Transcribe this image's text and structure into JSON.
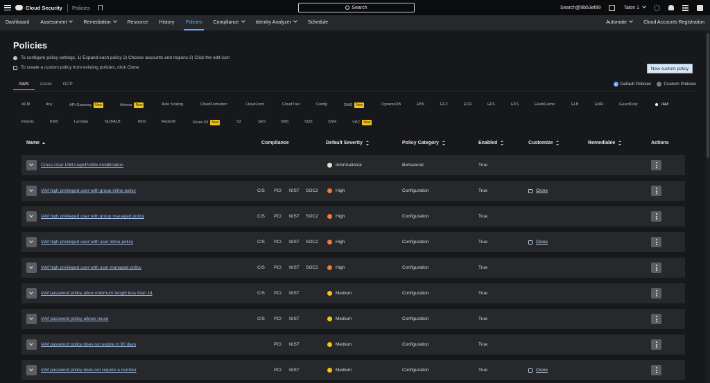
{
  "topbar": {
    "brand": "Cloud Security",
    "section": "Policies",
    "search_label": "Search",
    "account": "Search@9b53ef89",
    "user": "Talon 1"
  },
  "nav": {
    "items": [
      {
        "label": "Dashboard",
        "dropdown": false
      },
      {
        "label": "Assessment",
        "dropdown": true
      },
      {
        "label": "Remediation",
        "dropdown": true
      },
      {
        "label": "Resource",
        "dropdown": false
      },
      {
        "label": "History",
        "dropdown": false
      },
      {
        "label": "Policies",
        "dropdown": false,
        "active": true
      },
      {
        "label": "Compliance",
        "dropdown": true
      },
      {
        "label": "Identity Analyzer",
        "dropdown": true
      },
      {
        "label": "Schedule",
        "dropdown": false
      }
    ],
    "right": [
      {
        "label": "Automate",
        "dropdown": true
      },
      {
        "label": "Cloud Accounts Registration",
        "dropdown": false
      }
    ]
  },
  "page": {
    "title": "Policies",
    "info1": "To configure policy settings, 1) Expand each policy 2) Choose accounts and regions 3) Click the edit icon",
    "info2": "To create a custom policy from existing policies, click Clone",
    "new_policy_button": "New custom policy"
  },
  "cloud_tabs": [
    "AWS",
    "Azure",
    "GCP"
  ],
  "policy_filter": {
    "default_label": "Default Policies",
    "custom_label": "Custom Policies",
    "selected": "Default Policies"
  },
  "services_row1": [
    {
      "label": "ACM"
    },
    {
      "label": "Any"
    },
    {
      "label": "API Gateway",
      "badge": "New"
    },
    {
      "label": "Athena",
      "badge": "New"
    },
    {
      "label": "Auto Scaling"
    },
    {
      "label": "CloudFormation"
    },
    {
      "label": "CloudFront"
    },
    {
      "label": "CloudTrail"
    },
    {
      "label": "Config"
    },
    {
      "label": "DMS",
      "badge": "New"
    },
    {
      "label": "DynamoDB"
    },
    {
      "label": "EBS"
    },
    {
      "label": "EC2"
    },
    {
      "label": "ECR"
    },
    {
      "label": "EFS"
    },
    {
      "label": "EKS"
    },
    {
      "label": "ElastiCache"
    },
    {
      "label": "ELB"
    },
    {
      "label": "EMR"
    },
    {
      "label": "GuardDuty"
    },
    {
      "label": "IAM",
      "selected": true
    }
  ],
  "services_row2": [
    {
      "label": "Kinesis"
    },
    {
      "label": "KMS"
    },
    {
      "label": "Lambda"
    },
    {
      "label": "NLB/ALB"
    },
    {
      "label": "RDS"
    },
    {
      "label": "Redshift"
    },
    {
      "label": "Route 53",
      "badge": "New"
    },
    {
      "label": "S3"
    },
    {
      "label": "SES"
    },
    {
      "label": "SNS"
    },
    {
      "label": "SQS"
    },
    {
      "label": "SSM"
    },
    {
      "label": "VPC",
      "badge": "New"
    }
  ],
  "table": {
    "headers": {
      "name": "Name",
      "compliance": "Compliance",
      "severity": "Default Severity",
      "category": "Policy Category",
      "enabled": "Enabled",
      "customize": "Customize",
      "remediable": "Remediable",
      "actions": "Actions"
    },
    "clone_label": "Clone",
    "severity_colors": {
      "Informational": "#c9f2c0",
      "High": "#f07a3a",
      "Medium": "#f2c617"
    },
    "rows": [
      {
        "name": "Cross-User IAM LoginProfile modification",
        "cis": "",
        "pci": "",
        "nist": "",
        "soc2": "",
        "severity": "Informational",
        "category": "Behavioral",
        "enabled": "True",
        "clone": false
      },
      {
        "name": "IAM high privileged user with group inline policy",
        "cis": "CIS",
        "pci": "PCI",
        "nist": "NIST",
        "soc2": "SOC2",
        "severity": "High",
        "category": "Configuration",
        "enabled": "True",
        "clone": true
      },
      {
        "name": "IAM high privileged user with group managed policy",
        "cis": "CIS",
        "pci": "PCI",
        "nist": "NIST",
        "soc2": "SOC2",
        "severity": "High",
        "category": "Configuration",
        "enabled": "True",
        "clone": false
      },
      {
        "name": "IAM high privileged user with user inline policy",
        "cis": "CIS",
        "pci": "PCI",
        "nist": "NIST",
        "soc2": "SOC2",
        "severity": "High",
        "category": "Configuration",
        "enabled": "True",
        "clone": true
      },
      {
        "name": "IAM high privileged user with user managed policy",
        "cis": "CIS",
        "pci": "PCI",
        "nist": "NIST",
        "soc2": "SOC2",
        "severity": "High",
        "category": "Configuration",
        "enabled": "True",
        "clone": false
      },
      {
        "name": "IAM password policy allow minimum length less than 14",
        "cis": "CIS",
        "pci": "PCI",
        "nist": "NIST",
        "soc2": "",
        "severity": "Medium",
        "category": "Configuration",
        "enabled": "True",
        "clone": false
      },
      {
        "name": "IAM password policy allows reuse",
        "cis": "CIS",
        "pci": "PCI",
        "nist": "NIST",
        "soc2": "",
        "severity": "Medium",
        "category": "Configuration",
        "enabled": "True",
        "clone": false
      },
      {
        "name": "IAM password policy does not expire in 90 days",
        "cis": "",
        "pci": "PCI",
        "nist": "NIST",
        "soc2": "",
        "severity": "Medium",
        "category": "Configuration",
        "enabled": "True",
        "clone": false
      },
      {
        "name": "IAM password policy does not require a number",
        "cis": "",
        "pci": "PCI",
        "nist": "NIST",
        "soc2": "",
        "severity": "Medium",
        "category": "Configuration",
        "enabled": "True",
        "clone": true
      }
    ]
  }
}
